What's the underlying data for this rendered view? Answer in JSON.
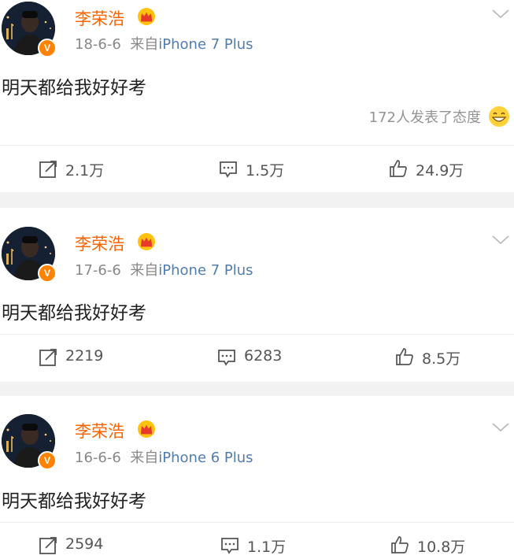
{
  "posts": [
    {
      "author": "李荣浩",
      "date": "18-6-6",
      "source_prefix": "来自",
      "device": "iPhone 7 Plus",
      "verified_badge": "V",
      "content": "明天都给我好好考",
      "reactions_text": "172人发表了态度",
      "reactions_icon": "grinning-emoji-icon",
      "repost": "2.1万",
      "comment": "1.5万",
      "like": "24.9万"
    },
    {
      "author": "李荣浩",
      "date": "17-6-6",
      "source_prefix": "来自",
      "device": "iPhone 7 Plus",
      "verified_badge": "V",
      "content": "明天都给我好好考",
      "repost": "2219",
      "comment": "6283",
      "like": "8.5万"
    },
    {
      "author": "李荣浩",
      "date": "16-6-6",
      "source_prefix": "来自",
      "device": "iPhone 6 Plus",
      "verified_badge": "V",
      "content": "明天都给我好好考",
      "repost": "2594",
      "comment": "1.1万",
      "like": "10.8万"
    }
  ],
  "icons": {
    "repost": "repost-icon",
    "comment": "comment-icon",
    "like": "thumbs-up-icon",
    "menu": "chevron-down-icon",
    "crown": "crown-icon"
  },
  "colors": {
    "author_name": "#f86400",
    "device_link": "#507daf",
    "meta_gray": "#888888",
    "verified_orange": "#ff8200",
    "separator": "#f2f2f2"
  }
}
